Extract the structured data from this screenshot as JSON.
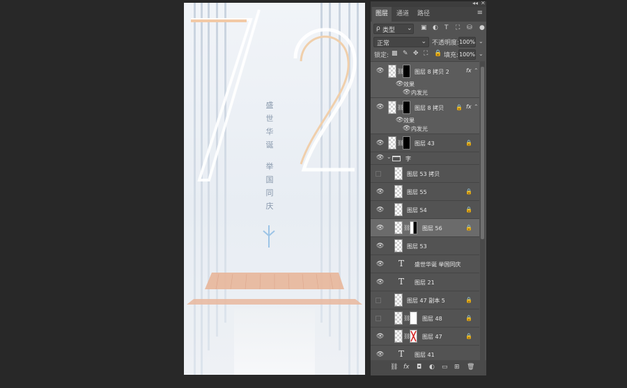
{
  "canvas": {
    "poem_line1": [
      "盛",
      "世",
      "华",
      "诞"
    ],
    "poem_line2": [
      "举",
      "国",
      "同",
      "庆"
    ],
    "big_digits": "72"
  },
  "panel": {
    "collapse_glyph": "◂◂",
    "close_glyph": "✕",
    "tabs": [
      {
        "label": "图层",
        "active": true
      },
      {
        "label": "通道",
        "active": false
      },
      {
        "label": "路径",
        "active": false
      }
    ],
    "menu_icon": "≡",
    "filter": {
      "search_glyph": "ρ",
      "kind_label": "类型",
      "arrow": "⌄"
    },
    "filter_icons": [
      "▣",
      "◐",
      "T",
      "⛶",
      "⛁",
      "●"
    ],
    "blend_mode": "正常",
    "opacity_label": "不透明度:",
    "opacity_value": "100%",
    "lock_label": "锁定:",
    "lock_icons": [
      "▩",
      "✎",
      "✥",
      "⛶",
      "🔒"
    ],
    "fill_label": "填充:",
    "fill_value": "100%",
    "dropdown_arrow": "⌄"
  },
  "layers": [
    {
      "name": "图层 8 拷贝 2",
      "kind": "mask-black",
      "fx": true,
      "locked": false,
      "effects": [
        "效果",
        "内发光"
      ]
    },
    {
      "name": "图层 8 拷贝",
      "kind": "mask-black",
      "fx": true,
      "locked": true,
      "effects": [
        "效果",
        "内发光"
      ]
    },
    {
      "name": "图层 43",
      "kind": "mask-black",
      "fx": false,
      "locked": true
    },
    {
      "name": "字",
      "kind": "group"
    },
    {
      "name": "图层 53 拷贝",
      "kind": "pixel",
      "hidden": true
    },
    {
      "name": "图层 55",
      "kind": "pixel",
      "locked": true
    },
    {
      "name": "图层 54",
      "kind": "pixel",
      "locked": true
    },
    {
      "name": "图层 56",
      "kind": "mask-half",
      "locked": true,
      "selected": true
    },
    {
      "name": "图层 53",
      "kind": "pixel"
    },
    {
      "name": "盛世华诞  举国同庆",
      "kind": "text"
    },
    {
      "name": "图层 21",
      "kind": "text"
    },
    {
      "name": "图层 47 副本 5",
      "kind": "pixel",
      "hidden": true,
      "locked": true
    },
    {
      "name": "图层 48",
      "kind": "mask-white",
      "hidden": true,
      "locked": true
    },
    {
      "name": "图层 47",
      "kind": "mask-redx",
      "locked": true
    },
    {
      "name": "图层 41",
      "kind": "text"
    }
  ],
  "glyphs": {
    "eye": "👁",
    "chain": "⛓",
    "lock": "🔒",
    "fx": "fx",
    "caret": "⌃",
    "group_caret": "⌄",
    "text_layer": "T"
  },
  "footer_icons": [
    "⛓",
    "fx",
    "◘",
    "◐",
    "▭",
    "⊞",
    "🗑"
  ]
}
